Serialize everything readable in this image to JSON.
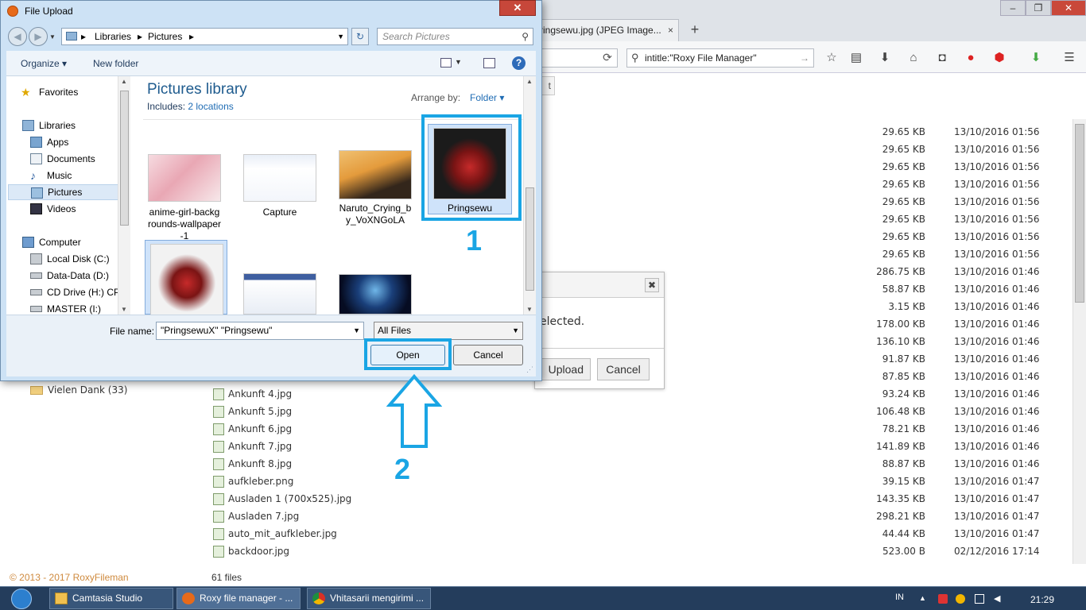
{
  "browser": {
    "tab_title": "ringsewu.jpg (JPEG Image...",
    "tab_close": "×",
    "new_tab": "+",
    "reload": "⟳",
    "search_value": "intitle:\"Roxy File Manager\"",
    "search_go": "→",
    "partial_button": "t",
    "window_controls": [
      "–",
      "❐",
      "✕"
    ],
    "toolbar_icons": [
      "star-icon",
      "reading-list-icon",
      "download-icon",
      "home-icon",
      "pocket-icon",
      "shield-icon",
      "adblock-icon",
      "green-arrow-icon",
      "menu-icon"
    ]
  },
  "file_list": {
    "rows": [
      {
        "name": "",
        "size": "29.65 KB",
        "date": "13/10/2016 01:56"
      },
      {
        "name": "",
        "size": "29.65 KB",
        "date": "13/10/2016 01:56"
      },
      {
        "name": "",
        "size": "29.65 KB",
        "date": "13/10/2016 01:56"
      },
      {
        "name": "",
        "size": "29.65 KB",
        "date": "13/10/2016 01:56"
      },
      {
        "name": "",
        "size": "29.65 KB",
        "date": "13/10/2016 01:56"
      },
      {
        "name": "",
        "size": "29.65 KB",
        "date": "13/10/2016 01:56"
      },
      {
        "name": "",
        "size": "29.65 KB",
        "date": "13/10/2016 01:56"
      },
      {
        "name": "",
        "size": "29.65 KB",
        "date": "13/10/2016 01:56"
      },
      {
        "name": "",
        "size": "286.75 KB",
        "date": "13/10/2016 01:46"
      },
      {
        "name": "",
        "size": "58.87 KB",
        "date": "13/10/2016 01:46"
      },
      {
        "name": "",
        "size": "3.15 KB",
        "date": "13/10/2016 01:46"
      },
      {
        "name": "",
        "size": "178.00 KB",
        "date": "13/10/2016 01:46"
      },
      {
        "name": "",
        "size": "136.10 KB",
        "date": "13/10/2016 01:46"
      },
      {
        "name": "",
        "size": "91.87 KB",
        "date": "13/10/2016 01:46"
      },
      {
        "name": "",
        "size": "87.85 KB",
        "date": "13/10/2016 01:46"
      },
      {
        "name": "Ankunft 4.jpg",
        "size": "93.24 KB",
        "date": "13/10/2016 01:46"
      },
      {
        "name": "Ankunft 5.jpg",
        "size": "106.48 KB",
        "date": "13/10/2016 01:46"
      },
      {
        "name": "Ankunft 6.jpg",
        "size": "78.21 KB",
        "date": "13/10/2016 01:46"
      },
      {
        "name": "Ankunft 7.jpg",
        "size": "141.89 KB",
        "date": "13/10/2016 01:46"
      },
      {
        "name": "Ankunft 8.jpg",
        "size": "88.87 KB",
        "date": "13/10/2016 01:46"
      },
      {
        "name": "aufkleber.png",
        "size": "39.15 KB",
        "date": "13/10/2016 01:47"
      },
      {
        "name": "Ausladen 1 (700x525).jpg",
        "size": "143.35 KB",
        "date": "13/10/2016 01:47"
      },
      {
        "name": "Ausladen 7.jpg",
        "size": "298.21 KB",
        "date": "13/10/2016 01:47"
      },
      {
        "name": "auto_mit_aufkleber.jpg",
        "size": "44.44 KB",
        "date": "13/10/2016 01:47"
      },
      {
        "name": "backdoor.jpg",
        "size": "523.00 B",
        "date": "02/12/2016 17:14"
      }
    ],
    "folder_item": "Vielen Dank (33)",
    "file_count": "61 files",
    "copyright": "© 2013 - 2017 RoxyFileman"
  },
  "upload_dialog": {
    "close": "✖",
    "message": "elected.",
    "upload_label": "Upload",
    "cancel_label": "Cancel"
  },
  "dialog": {
    "title": "File Upload",
    "close": "✕",
    "back": "◀",
    "forward": "▶",
    "address": {
      "crumbs": [
        "Libraries",
        "Pictures"
      ],
      "sep": "▸"
    },
    "refresh": "↻",
    "search_placeholder": "Search Pictures",
    "search_icon": "⚲",
    "organize": "Organize ▾",
    "new_folder": "New folder",
    "help": "?",
    "nav": {
      "favorites": "Favorites",
      "libraries": "Libraries",
      "apps": "Apps",
      "documents": "Documents",
      "music": "Music",
      "pictures": "Pictures",
      "videos": "Videos",
      "computer": "Computer",
      "local_disk": "Local Disk (C:)",
      "data_disk": "Data-Data (D:)",
      "cd_drive": "CD Drive (H:) CPI",
      "master": "MASTER (I:)"
    },
    "library_title": "Pictures library",
    "includes_label": "Includes:",
    "includes_value": "2 locations",
    "arrange_label": "Arrange by:",
    "arrange_value": "Folder ▾",
    "thumbnails": [
      {
        "caption": "anime-girl-backg rounds-wallpaper -1"
      },
      {
        "caption": "Capture"
      },
      {
        "caption": "Naruto_Crying_b y_VoXNGoLA"
      },
      {
        "caption": "Pringsewu"
      },
      {
        "caption": ""
      },
      {
        "caption": ""
      },
      {
        "caption": ""
      }
    ],
    "file_name_label": "File name:",
    "file_name_value": "\"PringsewuX\" \"Pringsewu\"",
    "file_type": "All Files",
    "open_label": "Open",
    "cancel_label": "Cancel"
  },
  "annotations": {
    "one": "1",
    "two": "2",
    "color": "#1aa5e4"
  },
  "taskbar": {
    "tasks": [
      "Camtasia Studio",
      "Roxy file manager - ...",
      "Vhitasarii mengirimi ..."
    ],
    "lang": "IN",
    "clock": "21:29"
  }
}
